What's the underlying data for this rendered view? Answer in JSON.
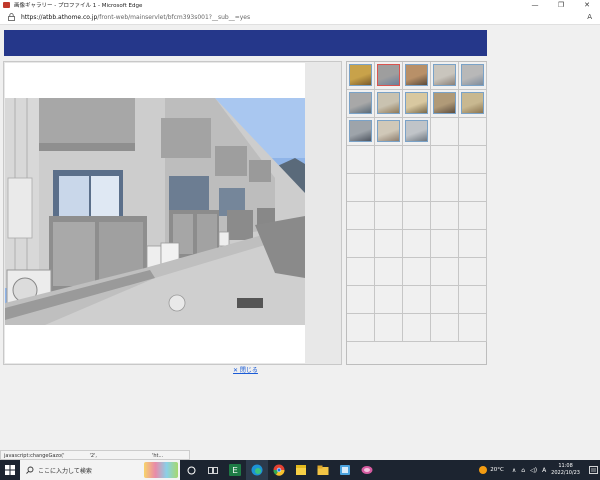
{
  "window": {
    "title": "画像ギャラリー - プロファイル 1 - Microsoft Edge",
    "minimize": "—",
    "restore": "❐",
    "close": "✕"
  },
  "addressbar": {
    "url_host": "https://atbb.athome.co.jp",
    "url_path": "/front-web/mainservlet/bfcm393s001?__sub__=yes",
    "reader_icon": "A"
  },
  "page": {
    "banner_color": "#25378a",
    "close_link": "✕ 閉じる",
    "thumbnails_filled": 13,
    "thumbnail_rows": 10,
    "thumbnail_cols": 5
  },
  "status": {
    "text": "javascript:changeGazo('　　　　　'2',　　　　　　　　　　　'ht..."
  },
  "taskbar": {
    "search_placeholder": "ここに入力して検索",
    "weather": "20°C",
    "ime": "A",
    "time": "11:08",
    "date": "2022/10/23",
    "tray_up": "∧",
    "tray_net": "⌂",
    "tray_vol": "◁)"
  }
}
